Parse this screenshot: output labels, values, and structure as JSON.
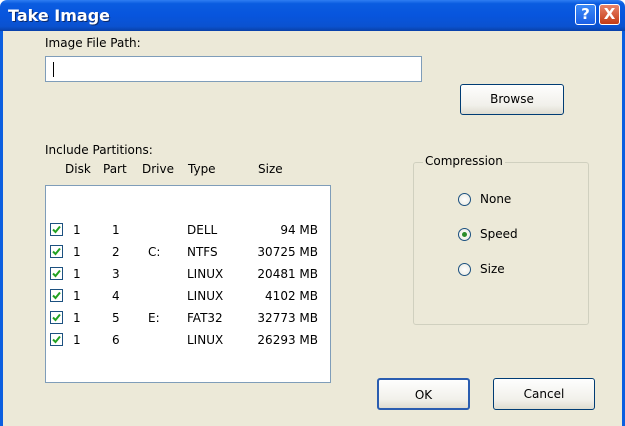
{
  "window": {
    "title": "Take Image",
    "help_label": "?",
    "close_label": "X"
  },
  "image_path": {
    "label": "Image File Path:",
    "value": ""
  },
  "browse_button": "Browse",
  "partitions": {
    "label": "Include Partitions:",
    "columns": [
      "Disk",
      "Part",
      "Drive",
      "Type",
      "Size"
    ],
    "rows": [
      {
        "checked": true,
        "disk": "1",
        "part": "1",
        "drive": "",
        "type": "DELL",
        "size": "94 MB"
      },
      {
        "checked": true,
        "disk": "1",
        "part": "2",
        "drive": "C:",
        "type": "NTFS",
        "size": "30725 MB"
      },
      {
        "checked": true,
        "disk": "1",
        "part": "3",
        "drive": "",
        "type": "LINUX",
        "size": "20481 MB"
      },
      {
        "checked": true,
        "disk": "1",
        "part": "4",
        "drive": "",
        "type": "LINUX",
        "size": "4102 MB"
      },
      {
        "checked": true,
        "disk": "1",
        "part": "5",
        "drive": "E:",
        "type": "FAT32",
        "size": "32773 MB"
      },
      {
        "checked": true,
        "disk": "1",
        "part": "6",
        "drive": "",
        "type": "LINUX",
        "size": "26293 MB"
      }
    ]
  },
  "compression": {
    "label": "Compression",
    "options": [
      {
        "label": "None",
        "selected": false
      },
      {
        "label": "Speed",
        "selected": true
      },
      {
        "label": "Size",
        "selected": false
      }
    ]
  },
  "ok_button": "OK",
  "cancel_button": "Cancel"
}
